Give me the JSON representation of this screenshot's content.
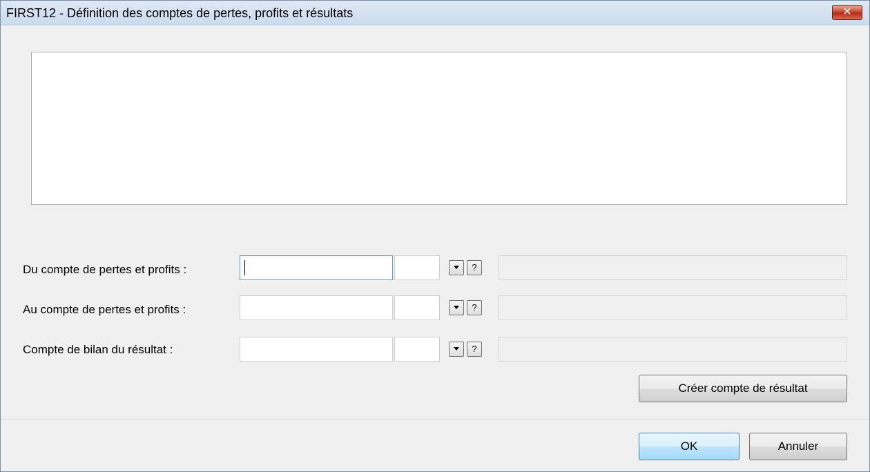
{
  "window": {
    "title": "FIRST12 - Définition des comptes de pertes, profits et résultats",
    "close_icon": "close-icon"
  },
  "description": {
    "value": ""
  },
  "form": {
    "rows": [
      {
        "label": "Du compte de pertes et profits :",
        "account": "",
        "suffix": "",
        "dropdown_icon": "chevron-down-icon",
        "help_label": "?",
        "name_value": ""
      },
      {
        "label": "Au compte de pertes et profits :",
        "account": "",
        "suffix": "",
        "dropdown_icon": "chevron-down-icon",
        "help_label": "?",
        "name_value": ""
      },
      {
        "label": "Compte de bilan du résultat :",
        "account": "",
        "suffix": "",
        "dropdown_icon": "chevron-down-icon",
        "help_label": "?",
        "name_value": ""
      }
    ],
    "create_button": "Créer compte de résultat"
  },
  "footer": {
    "ok_label": "OK",
    "cancel_label": "Annuler"
  },
  "colors": {
    "close_button": "#c8452f",
    "focus_border": "#5e99d2",
    "default_button": "#bee6fd"
  }
}
